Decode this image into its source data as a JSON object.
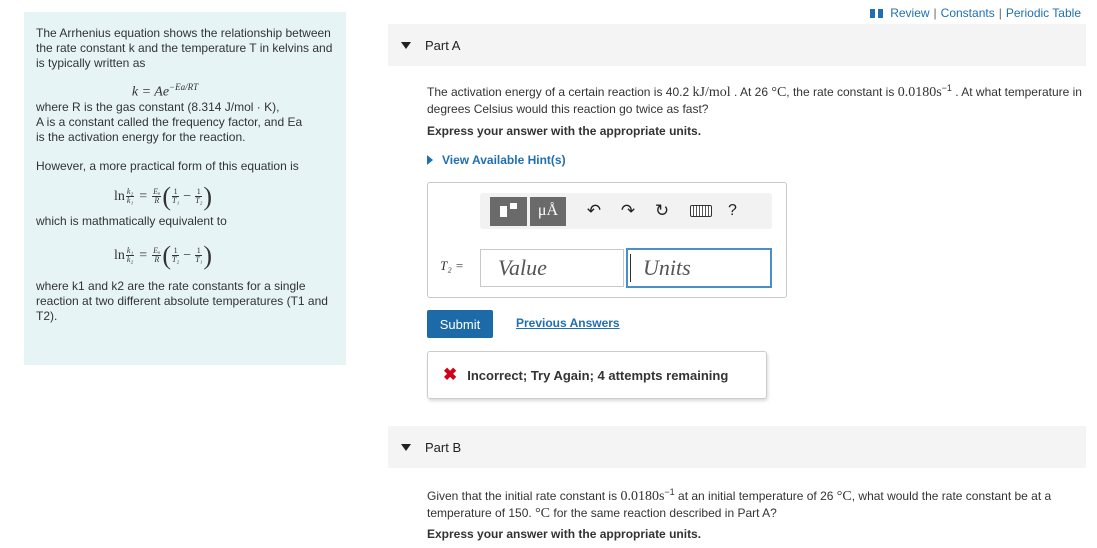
{
  "links": {
    "review": "Review",
    "sep": "|",
    "constants": "Constants",
    "periodic": "Periodic Table"
  },
  "info": {
    "intro": "The Arrhenius equation shows the relationship between the rate constant k and the temperature T in kelvins and is typically written as",
    "eq1": "k = Ae",
    "eq1_exp": "−Ea/RT",
    "where1_a": "where R is the gas constant (8.314 J/mol · K),",
    "where1_b": "A is a constant called the frequency factor, and Ea",
    "where1_c": "is the activation energy for the reaction.",
    "practical": "However, a more practical form of this equation is",
    "equiv": "which is mathmatically equivalent to",
    "where2": "where k1 and k2 are the rate constants for a single reaction at two different absolute temperatures (T1 and T2)."
  },
  "partA": {
    "label": "Part A",
    "question_a": "The activation energy of a certain reaction is 40.2",
    "question_unit1": "kJ/mol",
    "question_b": ". At 26",
    "question_unit2": "°C",
    "question_c": ", the rate constant is",
    "question_val": "0.0180s",
    "question_exp": "−1",
    "question_d": ". At what temperature in degrees Celsius would this reaction go twice as fast?",
    "instruction": "Express your answer with the appropriate units.",
    "hint": "View Available Hint(s)",
    "var_label": "T₂ =",
    "value_placeholder": "Value",
    "units_placeholder": "Units",
    "submit": "Submit",
    "previous": "Previous Answers",
    "feedback": "Incorrect; Try Again; 4 attempts remaining"
  },
  "toolbar": {
    "mu": "μÅ",
    "undo": "↶",
    "redo": "↷",
    "reset": "↻",
    "help": "?"
  },
  "partB": {
    "label": "Part B",
    "question_a": "Given that the initial rate constant is",
    "question_val": "0.0180s",
    "question_exp": "−1",
    "question_b": "at an initial temperature of 26",
    "question_unit1": "°C",
    "question_c": ", what would the rate constant be at a temperature of 150.",
    "question_unit2": "°C",
    "question_d": "for the same reaction described in Part A?",
    "instruction": "Express your answer with the appropriate units."
  }
}
